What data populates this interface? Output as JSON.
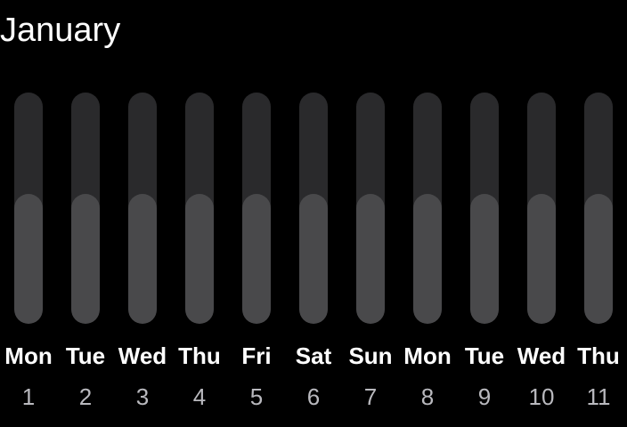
{
  "header": {
    "month": "January"
  },
  "colors": {
    "background": "#000000",
    "track": "#2a2a2c",
    "fill": "#49494b",
    "day_name": "#ffffff",
    "day_number": "#b9b9be"
  },
  "days": [
    {
      "name": "Mon",
      "number": "1",
      "level": 0.56
    },
    {
      "name": "Tue",
      "number": "2",
      "level": 0.56
    },
    {
      "name": "Wed",
      "number": "3",
      "level": 0.56
    },
    {
      "name": "Thu",
      "number": "4",
      "level": 0.56
    },
    {
      "name": "Fri",
      "number": "5",
      "level": 0.56
    },
    {
      "name": "Sat",
      "number": "6",
      "level": 0.56
    },
    {
      "name": "Sun",
      "number": "7",
      "level": 0.56
    },
    {
      "name": "Mon",
      "number": "8",
      "level": 0.56
    },
    {
      "name": "Tue",
      "number": "9",
      "level": 0.56
    },
    {
      "name": "Wed",
      "number": "10",
      "level": 0.56
    },
    {
      "name": "Thu",
      "number": "11",
      "level": 0.56
    }
  ]
}
